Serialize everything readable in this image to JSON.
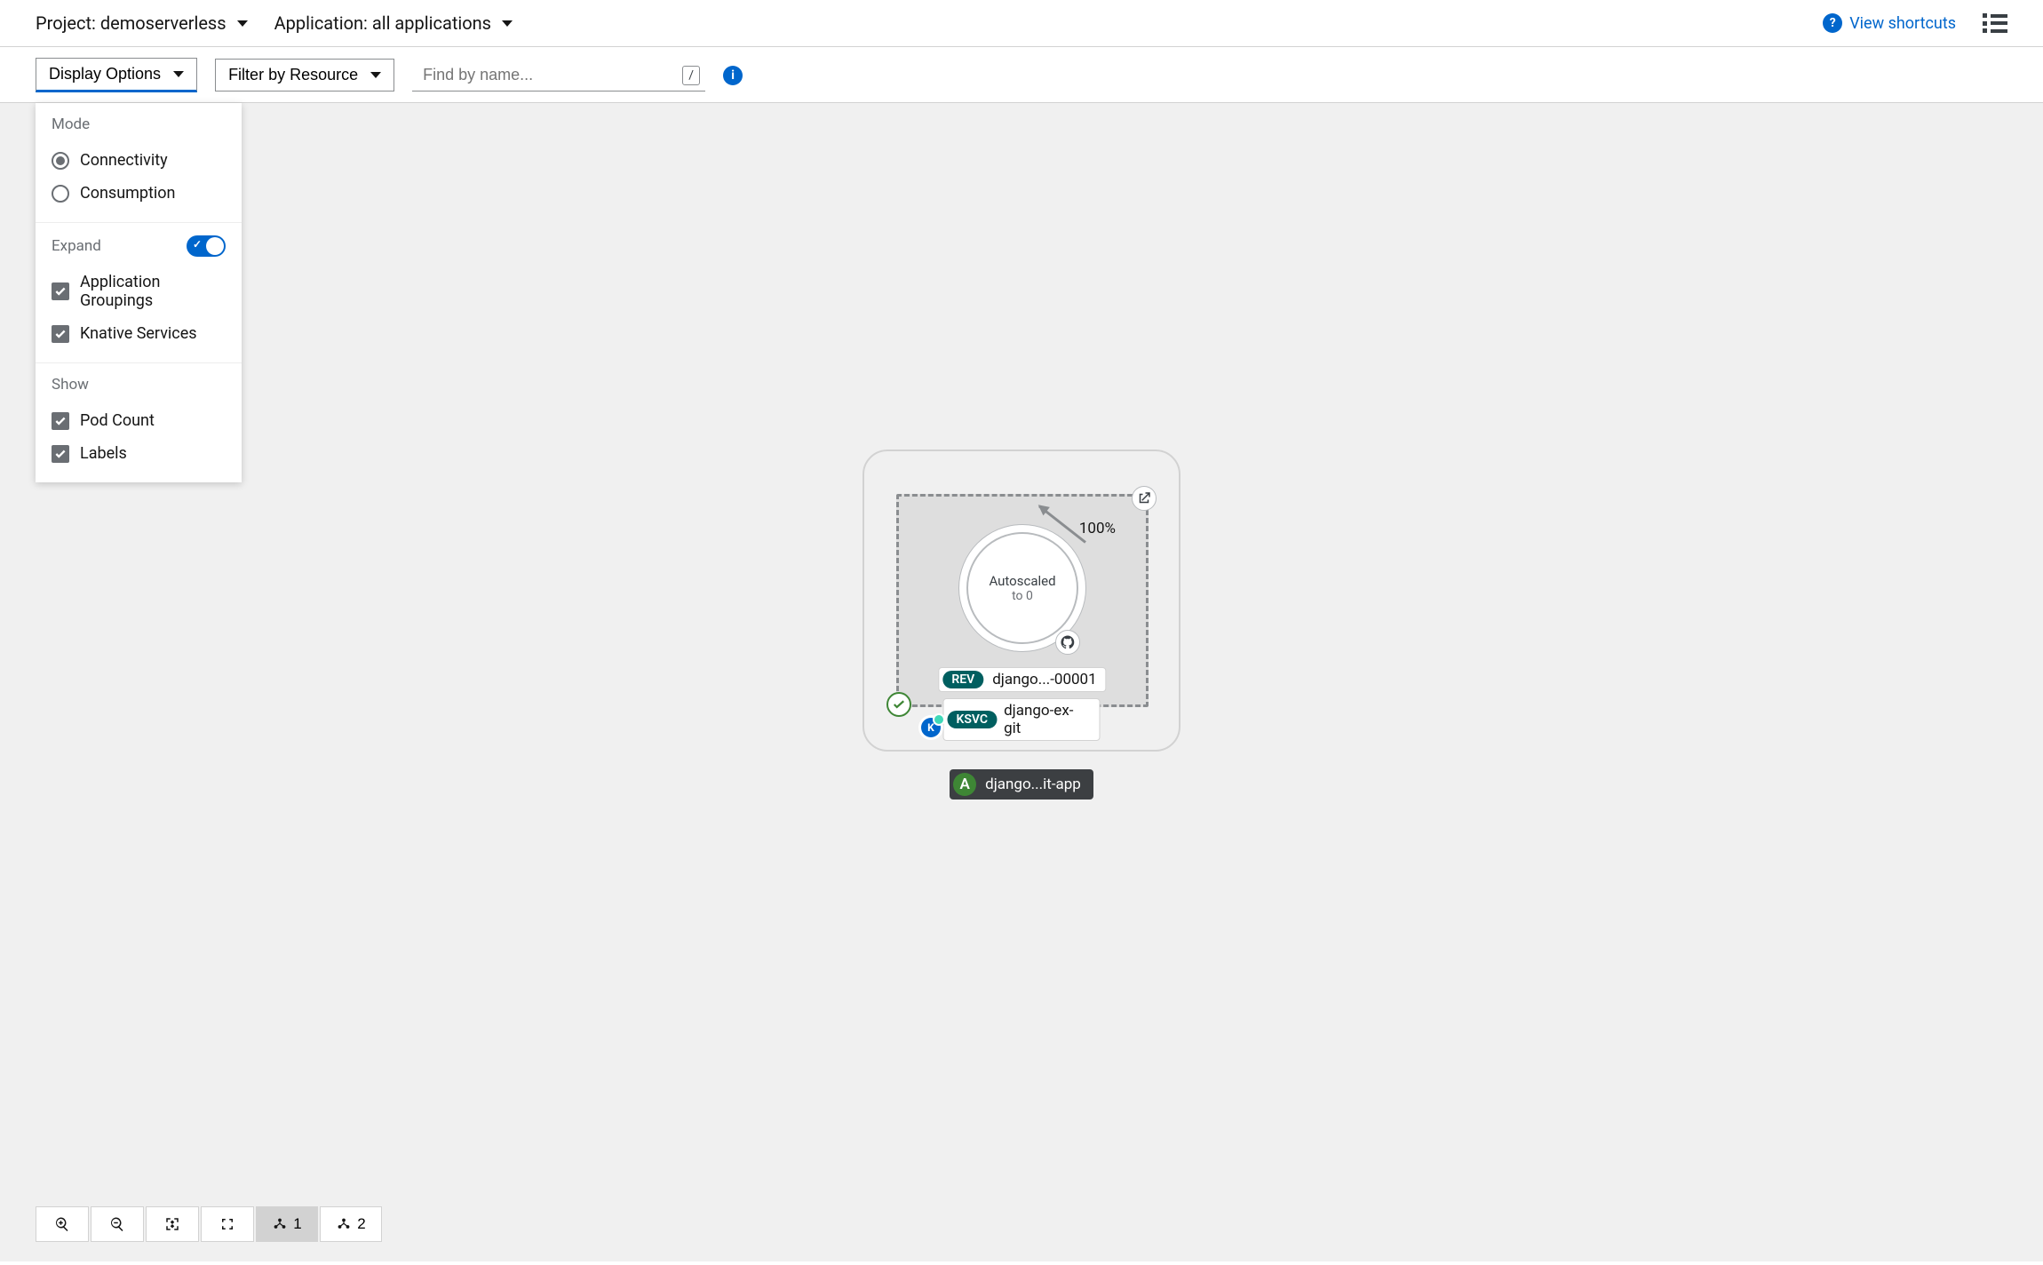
{
  "header": {
    "project_label": "Project: demoserverless",
    "application_label": "Application: all applications",
    "shortcuts_label": "View shortcuts"
  },
  "toolbar": {
    "display_options_label": "Display Options",
    "filter_label": "Filter by Resource",
    "search_placeholder": "Find by name...",
    "search_shortcut": "/"
  },
  "display_options": {
    "mode_label": "Mode",
    "mode_options": {
      "connectivity": "Connectivity",
      "consumption": "Consumption"
    },
    "mode_selected": "connectivity",
    "expand_label": "Expand",
    "expand_on": true,
    "expand_items": {
      "app_groupings": "Application Groupings",
      "knative": "Knative Services"
    },
    "show_label": "Show",
    "show_items": {
      "pod_count": "Pod Count",
      "labels": "Labels"
    }
  },
  "topology": {
    "traffic_percent": "100%",
    "pod_line1": "Autoscaled",
    "pod_line2": "to 0",
    "rev_badge": "REV",
    "rev_name": "django...-00001",
    "ksvc_badge": "KSVC",
    "ksvc_name": "django-ex-git",
    "knative_letter": "K",
    "app_badge_letter": "A",
    "app_name": "django...it-app"
  },
  "zoom": {
    "layout1": "1",
    "layout2": "2"
  }
}
